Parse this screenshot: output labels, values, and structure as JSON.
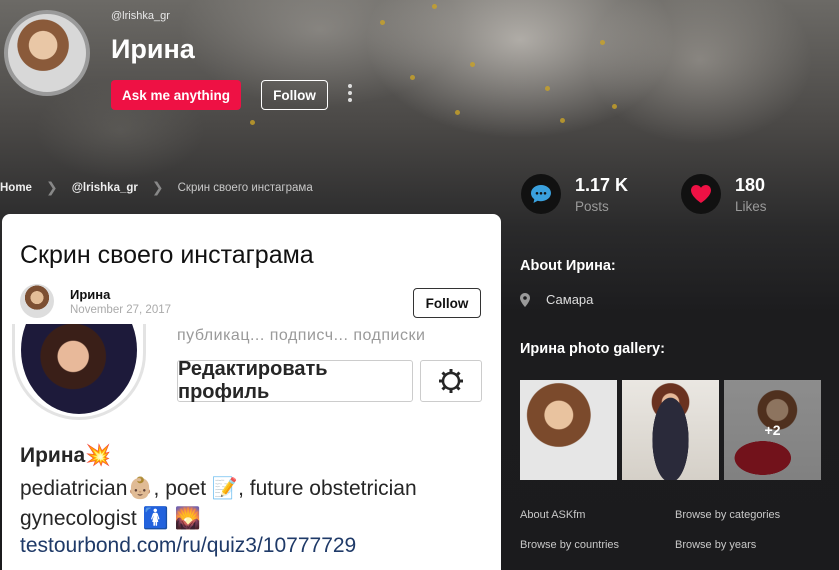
{
  "profile": {
    "username": "@lrishka_gr",
    "display_name": "Ирина",
    "ask_label": "Ask me anything",
    "follow_label": "Follow"
  },
  "breadcrumb": {
    "home": "Home",
    "user": "@lrishka_gr",
    "current": "Скрин своего инстаграма"
  },
  "post": {
    "title": "Скрин своего инстаграма",
    "author": "Ирина",
    "date": "November 27, 2017",
    "follow_label": "Follow"
  },
  "screenshot": {
    "stats_text": "публикац...  подписч...   подписки",
    "edit_profile": "Редактировать профиль",
    "name": "Ирина💥",
    "bio_line1": "pediatrician👶🏼, poet 📝, future obstetrician",
    "bio_line2": "gynecologist 🚺 🌄",
    "link": "testourbond.com/ru/quiz3/10777729"
  },
  "stats": {
    "posts_value": "1.17 K",
    "posts_label": "Posts",
    "likes_value": "180",
    "likes_label": "Likes"
  },
  "about": {
    "title": "About Ирина:",
    "location": "Самара"
  },
  "gallery": {
    "title": "Ирина photo gallery:",
    "more_count": "+2"
  },
  "footer": {
    "about_askfm": "About ASKfm",
    "browse_categories": "Browse by categories",
    "browse_countries": "Browse by countries",
    "browse_years": "Browse by years"
  },
  "colors": {
    "accent": "#ee1144",
    "background": "#1b1b1d",
    "icon_blue": "#3aa0dd"
  },
  "icons": [
    "more-vertical-icon",
    "chevron-right-icon",
    "speech-bubble-icon",
    "heart-icon",
    "location-pin-icon",
    "gear-icon"
  ]
}
